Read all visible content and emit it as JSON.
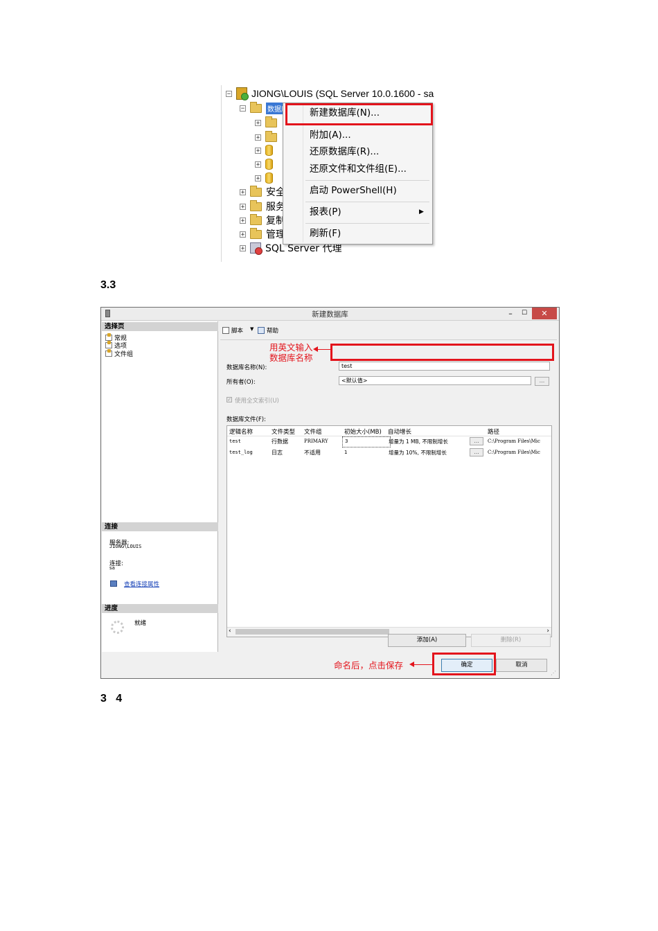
{
  "object_explorer": {
    "server_node": "JIONG\\LOUIS (SQL Server 10.0.1600 - sa",
    "databases_node": "数据库",
    "tree_items_partial": [
      "安全",
      "服务",
      "复制",
      "管理"
    ],
    "agent_node": "SQL Server 代理",
    "context_menu": {
      "items": [
        {
          "label": "新建数据库(N)...",
          "highlighted": true
        },
        {
          "label": "附加(A)..."
        },
        {
          "label": "还原数据库(R)..."
        },
        {
          "label": "还原文件和文件组(E)..."
        },
        {
          "label": "启动 PowerShell(H)"
        },
        {
          "label": "报表(P)",
          "submenu": true
        },
        {
          "label": "刷新(F)"
        }
      ]
    }
  },
  "step_labels": {
    "first": "3.3",
    "second": "3   4"
  },
  "dialog": {
    "title": "新建数据库",
    "titlebar_buttons": {
      "minimize": "–",
      "maximize": "☐",
      "close": "✕"
    },
    "left_pane": {
      "select_page_header": "选择页",
      "pages": [
        "常规",
        "选项",
        "文件组"
      ],
      "connection_header": "连接",
      "server_label": "服务器:",
      "server_value": "JIONG\\LOUIS",
      "connection_label": "连接:",
      "connection_value": "sa",
      "view_props_link": "查看连接属性",
      "progress_header": "进度",
      "progress_status": "就绪"
    },
    "toolbar": {
      "script_label": "脚本",
      "help_label": "帮助"
    },
    "form": {
      "db_name_label": "数据库名称(N):",
      "db_name_value": "test",
      "owner_label": "所有者(O):",
      "owner_value": "<默认值>",
      "fulltext_label": "使用全文索引(U)",
      "files_label": "数据库文件(F):"
    },
    "grid": {
      "columns": [
        "逻辑名称",
        "文件类型",
        "文件组",
        "初始大小(MB)",
        "自动增长",
        "路径"
      ],
      "rows": [
        [
          "test",
          "行数据",
          "PRIMARY",
          "3",
          "增量为 1 MB, 不限制增长",
          "C:\\Program Files\\Mic"
        ],
        [
          "test_log",
          "日志",
          "不适用",
          "1",
          "增量为 10%, 不限制增长",
          "C:\\Program Files\\Mic"
        ]
      ]
    },
    "buttons": {
      "add": "添加(A)",
      "remove": "删除(R)",
      "ok": "确定",
      "cancel": "取消",
      "ellipsis": "..."
    },
    "annotations": {
      "name_hint_line1": "用英文输入",
      "name_hint_line2": "数据库名称",
      "save_hint": "命名后，点击保存"
    }
  },
  "colors": {
    "highlight_red": "#e3141c",
    "close_button": "#c74a47"
  }
}
